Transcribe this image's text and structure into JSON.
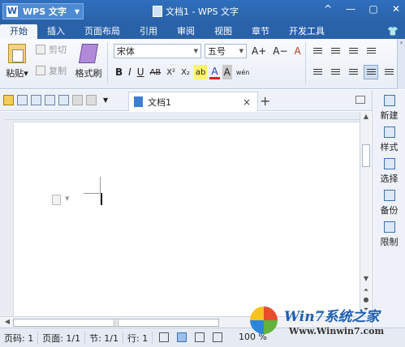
{
  "app": {
    "name": "WPS 文字",
    "logo_letter": "W"
  },
  "window": {
    "title": "文档1 - WPS 文字",
    "buttons": [
      "^",
      "—",
      "▢",
      "✕"
    ]
  },
  "ribbon_tabs": [
    {
      "label": "开始",
      "active": true
    },
    {
      "label": "插入"
    },
    {
      "label": "页面布局"
    },
    {
      "label": "引用"
    },
    {
      "label": "审阅"
    },
    {
      "label": "视图"
    },
    {
      "label": "章节"
    },
    {
      "label": "开发工具"
    }
  ],
  "clipboard": {
    "paste": "粘贴",
    "cut": "剪切",
    "copy": "复制",
    "format_painter": "格式刷"
  },
  "font": {
    "family": "宋体",
    "size": "五号",
    "grow": "A+",
    "shrink": "A−",
    "clear": "A",
    "bold": "B",
    "italic": "I",
    "underline": "U",
    "strike": "AB",
    "superscript": "X²",
    "subscript": "X₂",
    "highlight": "ab",
    "color": "A",
    "shade": "A",
    "phonetic": "wén"
  },
  "doc_tab": {
    "label": "文档1",
    "close": "×",
    "new": "+"
  },
  "task_pane": [
    {
      "label": "新建",
      "icon": "new-doc-icon"
    },
    {
      "label": "样式",
      "icon": "style-icon"
    },
    {
      "label": "选择",
      "icon": "select-icon"
    },
    {
      "label": "备份",
      "icon": "backup-icon"
    },
    {
      "label": "限制",
      "icon": "restrict-icon"
    }
  ],
  "status": {
    "page_num": "页码: 1",
    "pages": "页面: 1/1",
    "section": "节: 1/1",
    "row": "行: 1",
    "zoom": "100 %"
  },
  "watermark": {
    "title": "Win7系统之家",
    "url": "Www.Winwin7.com"
  }
}
